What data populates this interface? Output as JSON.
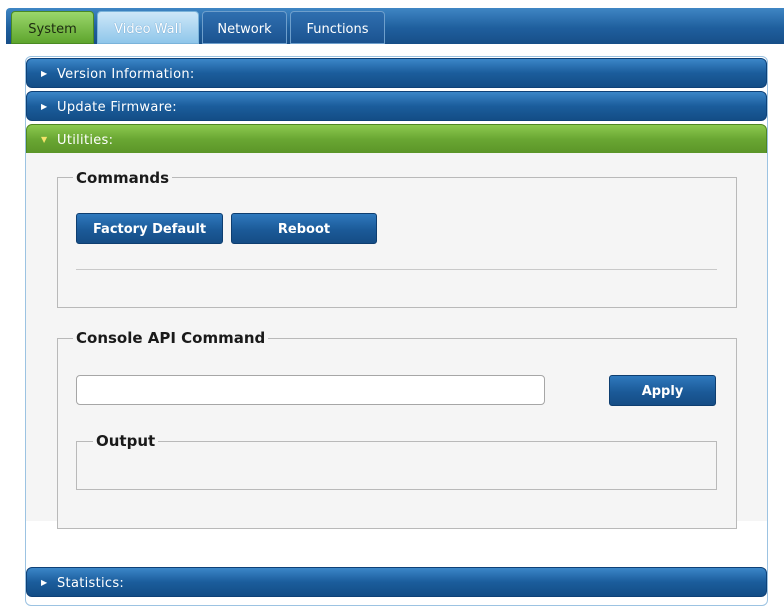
{
  "tabs": [
    {
      "label": "System"
    },
    {
      "label": "Video Wall"
    },
    {
      "label": "Network"
    },
    {
      "label": "Functions"
    }
  ],
  "sections": {
    "version": {
      "label": "Version Information:"
    },
    "firmware": {
      "label": "Update Firmware:"
    },
    "utilities": {
      "label": "Utilities:"
    },
    "statistics": {
      "label": "Statistics:"
    }
  },
  "commands": {
    "legend": "Commands",
    "factory_default_label": "Factory Default",
    "reboot_label": "Reboot"
  },
  "console": {
    "legend": "Console API Command",
    "input_value": "",
    "input_placeholder": "",
    "apply_label": "Apply",
    "output_legend": "Output"
  },
  "icons": {
    "collapsed": "caret-right-icon",
    "expanded": "caret-down-icon"
  },
  "colors": {
    "primary_blue": "#1b5d9c",
    "active_green": "#6aa733",
    "panel_bg": "#f5f5f5"
  }
}
